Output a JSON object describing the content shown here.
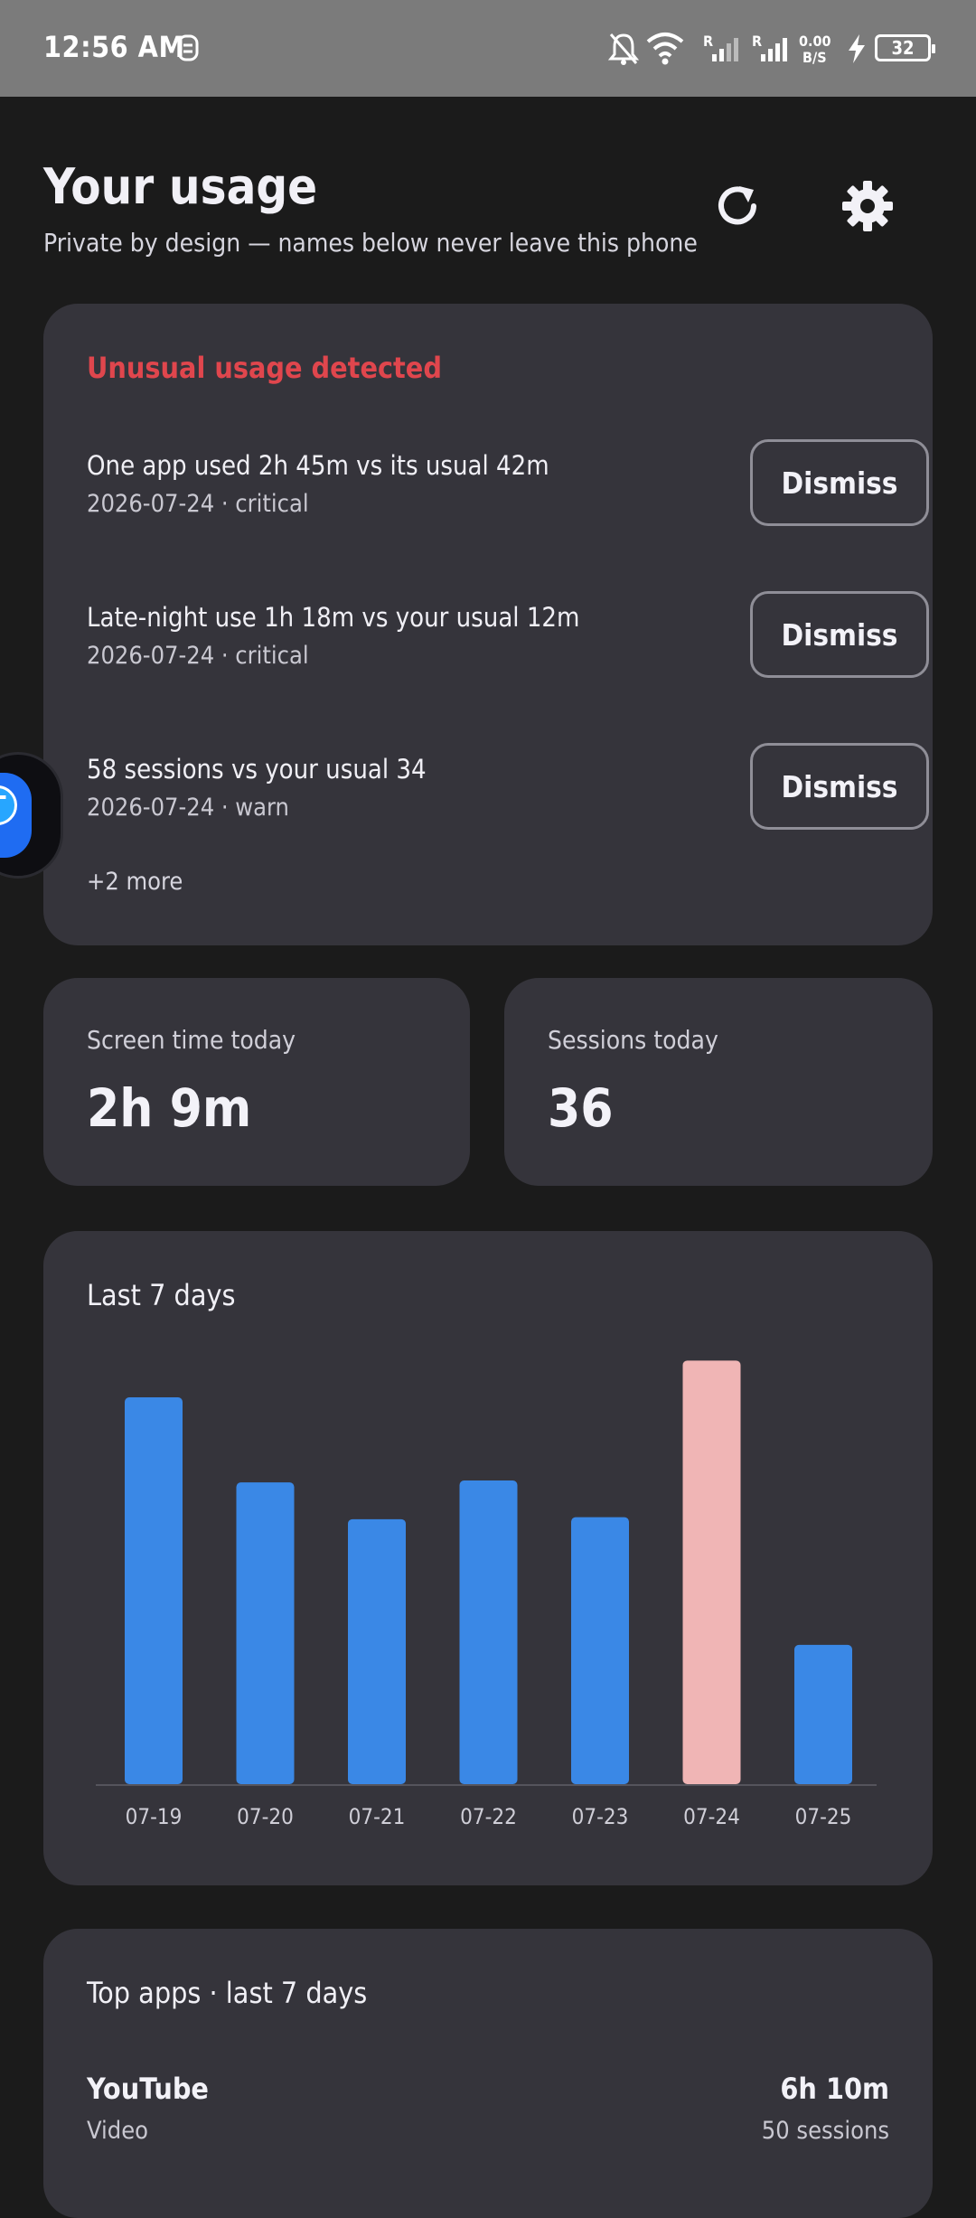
{
  "status_bar": {
    "time": "12:56 AM",
    "data_speed_value": "0.00",
    "data_speed_unit": "B/S",
    "signal_label": "R",
    "battery": "32",
    "icons": [
      "mute-notifications-icon",
      "wifi-icon",
      "signal-icon",
      "signal-icon",
      "charging-icon",
      "battery-icon"
    ]
  },
  "header": {
    "title": "Your usage",
    "subtitle": "Private by design — names below never leave this phone",
    "refresh_icon": "refresh-icon",
    "settings_icon": "gear-icon"
  },
  "alerts": {
    "title": "Unusual usage detected",
    "title_color": "#e0464d",
    "dismiss_label": "Dismiss",
    "items": [
      {
        "text": "One app used 2h 45m vs its usual 42m",
        "meta": "2026-07-24 · critical"
      },
      {
        "text": "Late-night use 1h 18m vs your usual 12m",
        "meta": "2026-07-24 · critical"
      },
      {
        "text": "58 sessions vs your usual 34",
        "meta": "2026-07-24 · warn"
      }
    ],
    "more": "+2 more"
  },
  "stats": {
    "screen_time_label": "Screen time today",
    "screen_time_value": "2h 9m",
    "sessions_label": "Sessions today",
    "sessions_value": "36"
  },
  "chart_data": {
    "type": "bar",
    "title": "Last 7 days",
    "categories": [
      "07-19",
      "07-20",
      "07-21",
      "07-22",
      "07-23",
      "07-24",
      "07-25"
    ],
    "values": [
      1.0,
      0.78,
      0.685,
      0.785,
      0.69,
      1.095,
      0.36
    ],
    "highlight_index": 5,
    "colors": {
      "normal": "#3a88e6",
      "highlight": "#f0b5b5",
      "axis": "#55545c"
    }
  },
  "top_apps": {
    "title": "Top apps · last 7 days",
    "items": [
      {
        "name": "YouTube",
        "category": "Video",
        "time": "6h 10m",
        "sessions": "50 sessions"
      }
    ]
  }
}
